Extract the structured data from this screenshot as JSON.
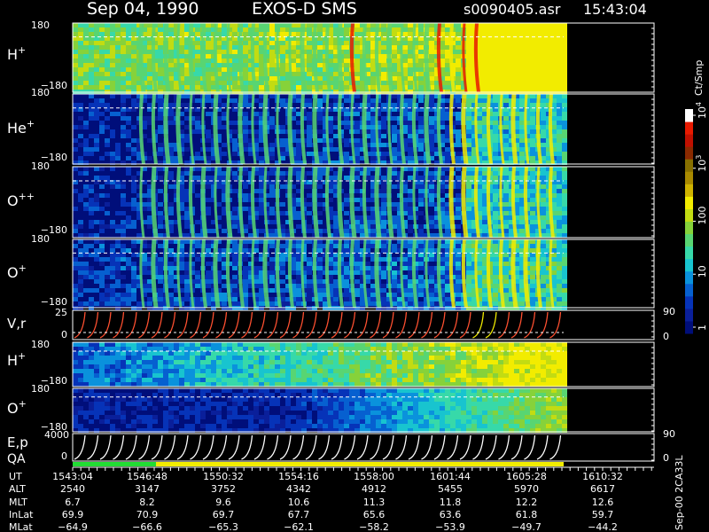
{
  "header": {
    "date": "Sep 04, 1990",
    "instrument": "EXOS-D SMS",
    "file": "s0090405.asr",
    "time": "15:43:04"
  },
  "colorbar": {
    "unit_label": "Ct/Smp",
    "ticks": [
      {
        "label": "1",
        "value": 1
      },
      {
        "label": "10",
        "value": 10
      },
      {
        "label": "100",
        "value": 100
      },
      {
        "label": "10",
        "sup": "3",
        "value": 1000
      },
      {
        "label": "10",
        "sup": "4",
        "value": 10000
      }
    ],
    "colors": [
      "#000e7a",
      "#0a1f9a",
      "#0633b8",
      "#0660d0",
      "#0a92dc",
      "#18c4cf",
      "#37d9a9",
      "#58d572",
      "#86d23a",
      "#c2dc12",
      "#f2ec00",
      "#cfb300",
      "#a98a00",
      "#887000",
      "#8a2a00",
      "#c01000",
      "#e81a00",
      "#ffffff"
    ]
  },
  "panels": {
    "h_plus": {
      "species": "H",
      "charge": "+",
      "ymax": "180",
      "ymin": "−180"
    },
    "he_plus": {
      "species": "He",
      "charge": "+",
      "ymax": "180",
      "ymin": "−180"
    },
    "o_pp": {
      "species": "O",
      "charge": "++",
      "ymax": "180",
      "ymin": "−180"
    },
    "o_plus": {
      "species": "O",
      "charge": "+",
      "ymax": "180",
      "ymin": "−180"
    },
    "vr": {
      "label": "V,r",
      "ymax": "25",
      "ymin": "0",
      "right_top": "90",
      "right_bottom": "0"
    },
    "h_plus_2": {
      "species": "H",
      "charge": "+",
      "ymax": "180",
      "ymin": "−180"
    },
    "o_plus_2": {
      "species": "O",
      "charge": "+",
      "ymax": "180",
      "ymin": "−180"
    },
    "ep": {
      "label1": "E,p",
      "label2": "QA",
      "ymax": "4000",
      "ymin": "0",
      "right_top": "90",
      "right_bottom": "0"
    }
  },
  "side_label": "Sep-00  2CA33L",
  "table": {
    "row_labels": [
      "UT",
      "ALT",
      "MLT",
      "InLat",
      "MLat"
    ],
    "columns": [
      [
        "1543:04",
        "2540",
        "6.7",
        "69.9",
        "−64.9"
      ],
      [
        "1546:48",
        "3147",
        "8.2",
        "70.9",
        "−66.6"
      ],
      [
        "1550:32",
        "3752",
        "9.6",
        "69.7",
        "−65.3"
      ],
      [
        "1554:16",
        "4342",
        "10.6",
        "67.7",
        "−62.1"
      ],
      [
        "1558:00",
        "4912",
        "11.3",
        "65.6",
        "−58.2"
      ],
      [
        "1601:44",
        "5455",
        "11.8",
        "63.6",
        "−53.9"
      ],
      [
        "1605:28",
        "5970",
        "12.2",
        "61.8",
        "−49.7"
      ],
      [
        "1610:32",
        "6617",
        "12.6",
        "59.7",
        "−44.2"
      ]
    ]
  },
  "chart_data": {
    "type": "heatmap",
    "title": "Sep 04, 1990    EXOS-D SMS",
    "x_axis_ticks": [
      "1543:04",
      "1546:48",
      "1550:32",
      "1554:16",
      "1558:00",
      "1601:44",
      "1605:28",
      "1610:32"
    ],
    "panels": [
      "H+",
      "He+",
      "O++",
      "O+",
      "V,r",
      "H+",
      "O+",
      "E,p / QA"
    ],
    "colorbar_unit": "Ct/Smp",
    "colorbar_range": [
      1,
      10000
    ],
    "colorbar_scale": "log",
    "pitch_angle_range": [
      -180,
      180
    ],
    "vr_range": [
      0,
      25
    ],
    "ep_range": [
      0,
      4000
    ],
    "qa_segments": [
      {
        "from": "1543:04",
        "to": "1546:48",
        "color": "#22dd33"
      },
      {
        "from": "1546:48",
        "to": "1610:32",
        "color": "#f2ec00"
      }
    ]
  }
}
